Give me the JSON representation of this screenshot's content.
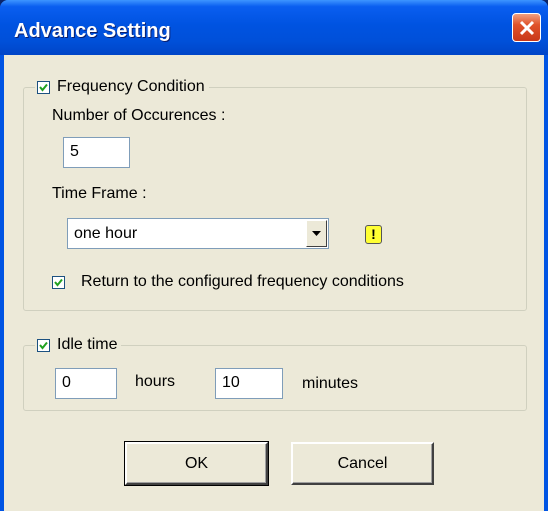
{
  "window": {
    "title": "Advance Setting"
  },
  "icons": {
    "close": "close-icon",
    "check": "checkmark-icon",
    "dropdown": "chevron-down-icon",
    "warning": "warning-icon"
  },
  "colors": {
    "titlebar": "#0054e3",
    "client": "#ece9d8",
    "close_button": "#e0522a",
    "warning": "#ffff33"
  },
  "frequency": {
    "legend": "Frequency Condition",
    "enabled": true,
    "occurrences_label": "Number of Occurences :",
    "occurrences_value": "5",
    "timeframe_label": "Time Frame :",
    "timeframe_value": "one hour",
    "warning_glyph": "!",
    "return_label": "Return to the configured frequency conditions",
    "return_checked": true
  },
  "idle": {
    "legend": "Idle time",
    "enabled": true,
    "hours_value": "0",
    "hours_label": "hours",
    "minutes_value": "10",
    "minutes_label": "minutes"
  },
  "buttons": {
    "ok": "OK",
    "cancel": "Cancel"
  }
}
